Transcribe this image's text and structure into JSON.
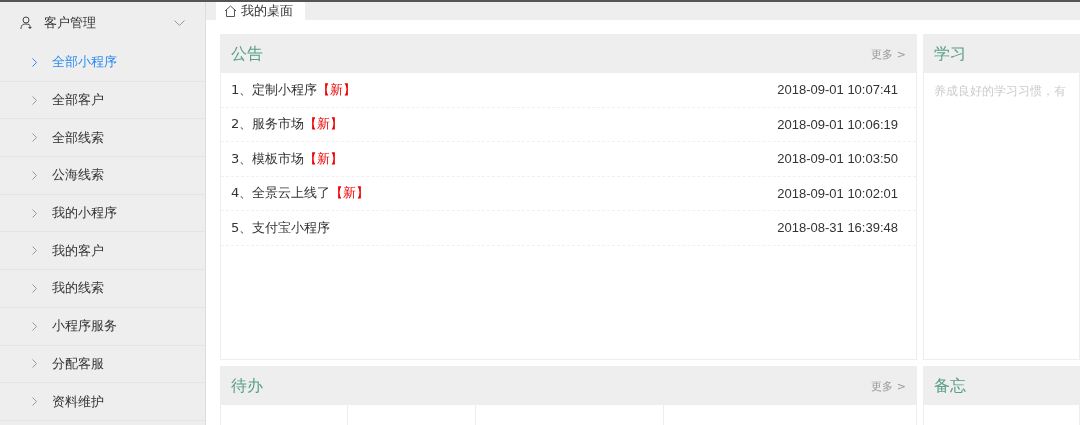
{
  "sidebar": {
    "group": {
      "label": "客户管理",
      "expanded": true
    },
    "items": [
      {
        "label": "全部小程序",
        "selected": true
      },
      {
        "label": "全部客户",
        "selected": false
      },
      {
        "label": "全部线索",
        "selected": false
      },
      {
        "label": "公海线索",
        "selected": false
      },
      {
        "label": "我的小程序",
        "selected": false
      },
      {
        "label": "我的客户",
        "selected": false
      },
      {
        "label": "我的线索",
        "selected": false
      },
      {
        "label": "小程序服务",
        "selected": false
      },
      {
        "label": "分配客服",
        "selected": false
      },
      {
        "label": "资料维护",
        "selected": false
      }
    ]
  },
  "tabs": [
    {
      "label": "我的桌面",
      "selected": true
    }
  ],
  "notice": {
    "title": "公告",
    "more": "更多 >",
    "items": [
      {
        "text": "1、定制小程序",
        "badge": "【新】",
        "time": "2018-09-01 10:07:41"
      },
      {
        "text": "2、服务市场",
        "badge": "【新】",
        "time": "2018-09-01 10:06:19"
      },
      {
        "text": "3、模板市场",
        "badge": "【新】",
        "time": "2018-09-01 10:03:50"
      },
      {
        "text": "4、全景云上线了",
        "badge": "【新】",
        "time": "2018-09-01 10:02:01"
      },
      {
        "text": "5、支付宝小程序",
        "time": "2018-08-31 16:39:48"
      }
    ]
  },
  "study": {
    "title": "学习",
    "text": "养成良好的学习习惯，有"
  },
  "todo": {
    "title": "待办",
    "more": "更多 >"
  },
  "memo": {
    "title": "备忘"
  }
}
